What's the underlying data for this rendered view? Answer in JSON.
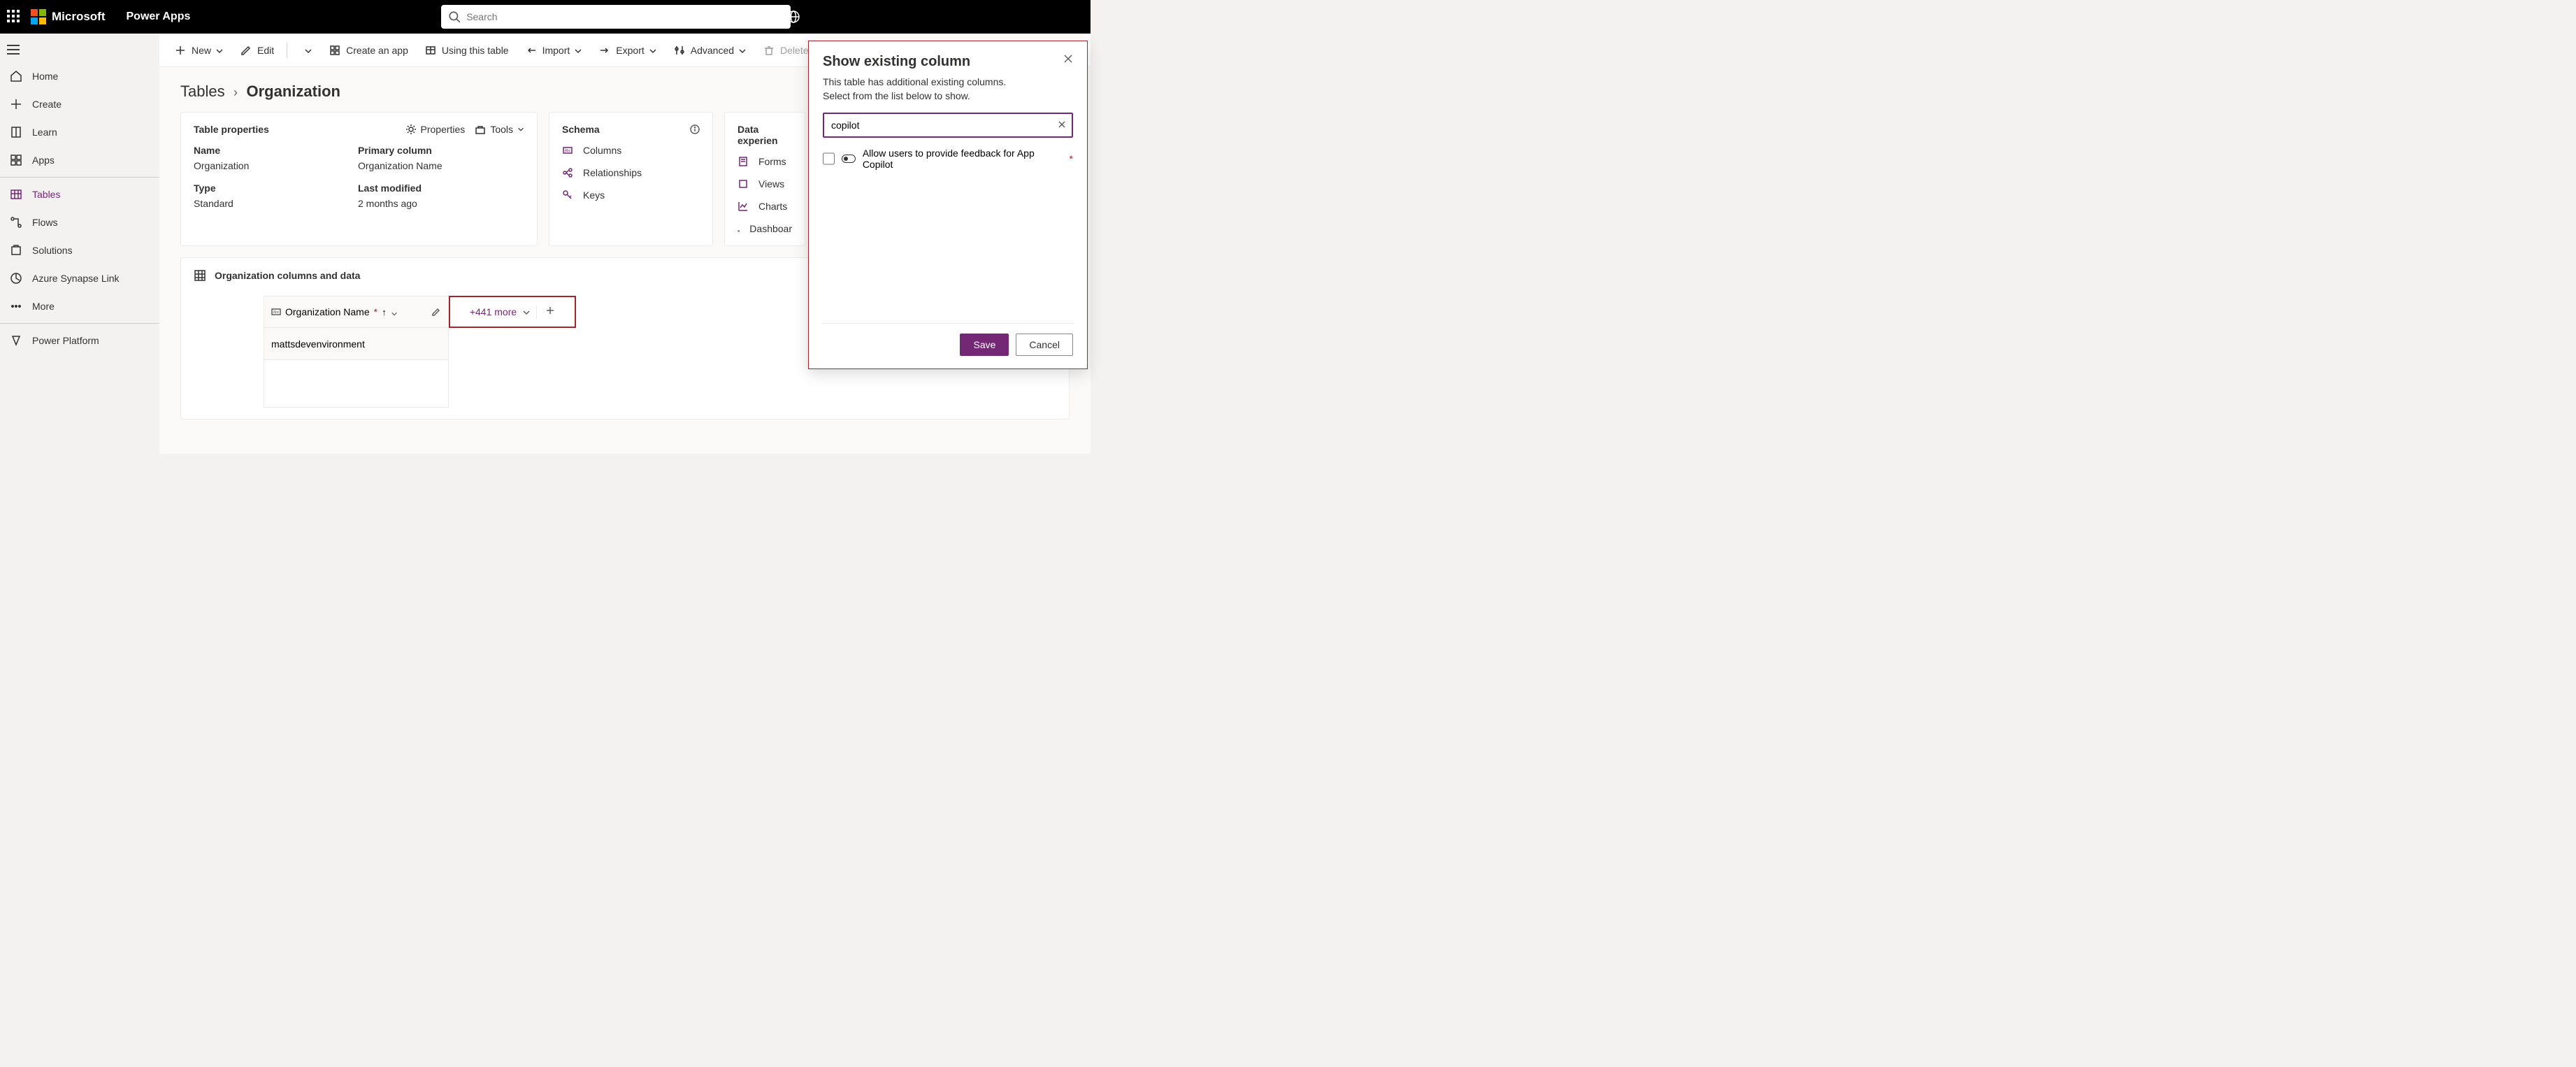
{
  "header": {
    "brand": "Microsoft",
    "product": "Power Apps",
    "search_placeholder": "Search"
  },
  "left_nav": {
    "items": [
      {
        "label": "Home"
      },
      {
        "label": "Create"
      },
      {
        "label": "Learn"
      },
      {
        "label": "Apps"
      },
      {
        "label": "Tables",
        "active": true
      },
      {
        "label": "Flows"
      },
      {
        "label": "Solutions"
      },
      {
        "label": "Azure Synapse Link"
      },
      {
        "label": "More"
      },
      {
        "label": "Power Platform"
      }
    ]
  },
  "command_bar": {
    "new": "New",
    "edit": "Edit",
    "create_app": "Create an app",
    "using_table": "Using this table",
    "import": "Import",
    "export": "Export",
    "advanced": "Advanced",
    "delete": "Delete"
  },
  "breadcrumb": {
    "parent": "Tables",
    "current": "Organization"
  },
  "table_properties": {
    "title": "Table properties",
    "properties_btn": "Properties",
    "tools_btn": "Tools",
    "fields": {
      "name_label": "Name",
      "name_value": "Organization",
      "primary_label": "Primary column",
      "primary_value": "Organization Name",
      "type_label": "Type",
      "type_value": "Standard",
      "modified_label": "Last modified",
      "modified_value": "2 months ago"
    }
  },
  "schema": {
    "title": "Schema",
    "items": [
      "Columns",
      "Relationships",
      "Keys"
    ]
  },
  "data_experience": {
    "title": "Data experien",
    "items": [
      "Forms",
      "Views",
      "Charts",
      "Dashboar"
    ]
  },
  "columns_data": {
    "title": "Organization columns and data",
    "column_header": "Organization Name",
    "more": "+441 more",
    "row_value": "mattsdevenvironment"
  },
  "flyout": {
    "title": "Show existing column",
    "subtitle_line1": "This table has additional existing columns.",
    "subtitle_line2": "Select from the list below to show.",
    "search_value": "copilot",
    "option_label": "Allow users to provide feedback for App Copilot",
    "save": "Save",
    "cancel": "Cancel"
  }
}
